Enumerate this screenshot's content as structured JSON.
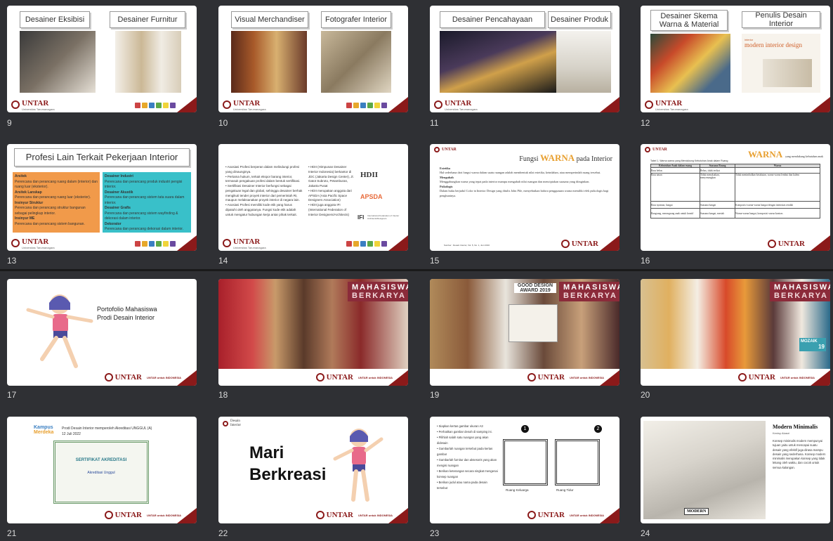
{
  "slides": {
    "s9": {
      "num": "9",
      "title_a": "Desainer Eksibisi",
      "title_b": "Desainer Furnitur"
    },
    "s10": {
      "num": "10",
      "title_a": "Visual Merchandiser",
      "title_b": "Fotografer Interior"
    },
    "s11": {
      "num": "11",
      "title_a": "Desainer Pencahayaan",
      "title_b": "Desainer Produk"
    },
    "s12": {
      "num": "12",
      "title_a": "Desainer Skema Warna & Material",
      "title_b": "Penulis Desain Interior",
      "book_small": "interior",
      "book_title": "modern interior design"
    },
    "s13": {
      "num": "13",
      "title": "Profesi Lain Terkait Pekerjaan Interior",
      "left": [
        {
          "h": "Arsitek",
          "d": "Perencana dan perancang ruang dalam (interior) dan ruang luar (eksterior)."
        },
        {
          "h": "Arsitek Lanskap",
          "d": "Perencana dan perancang ruang luar (eksterior)."
        },
        {
          "h": "Insinyur Struktur",
          "d": "Perencana dan perancang struktur bangunan sebagai pelingkup interior."
        },
        {
          "h": "Insinyur ME",
          "d": "Perencana dan perancang sistem bangunan."
        }
      ],
      "right": [
        {
          "h": "Desainer Industri",
          "d": "Perencana dan perancang produk industri pengisi interior."
        },
        {
          "h": "Desainer Akustik",
          "d": "Perencana dan perancang sistem tata suara dalam interior."
        },
        {
          "h": "Desainer Grafis",
          "d": "Perencana dan perancang sistem wayfinding & dekorasi dalam interior."
        },
        {
          "h": "Dekorator",
          "d": "Perencana dan perancang dekorasi dalam interior."
        }
      ]
    },
    "s14": {
      "num": "14",
      "bullets": [
        "Asosiasi Profesi berperan dalam melindungi profesi yang dinaunginya.",
        "Pertama hukum, terkait ekspor barang interior, termasuk pengakuan profesi dalam bentuk sertifikasi.",
        "Sertifikasi Desainer Interior berfungsi sebagai pengakuan legal dan global, sehingga desainer berhak mengikuti tender proyek interior dari pemerintah RI, maupun melaksanakan proyek interior di negara lain.",
        "Asosiasi Profesi memiliki kode etik yang harus dipatuhi oleh anggotanya. Fungsi kode etik adalah untuk mengatur hubungan kerja antar pihak terkait."
      ],
      "orgs": [
        "HDII (Himpunan Desainer Interior Indonesia) berkantor di JDC (Jakarta Design Center), Jl. Gatot Subroto, Petamburan, Jakarta Pusat",
        "HDII merupakan anggota dari APSDA (Asia Pacific Space Designers Association)",
        "HDII juga anggota IFI (International Federation of Interior Designers/Architects)"
      ],
      "logo1": "HDII",
      "logo2": "APSDA",
      "logo3": "IFI",
      "logo3_sub": "International Federation of Interior Architects/Designers"
    },
    "s15": {
      "num": "15",
      "title_pre": "Fungsi",
      "title_w": "WARNA",
      "title_post": "pada Interior",
      "items": [
        {
          "h": "Estetika",
          "d": "Hal sederhana dari fungsi warna dalam suatu ruangan adalah membentuk nilai estetika, keindahan, atau memperindah ruang tersebut."
        },
        {
          "h": "Mengubah",
          "d": "Menggabungkan warna yang tepat pada interior mampu mengubah nilai ruangan dan menciptakan suasana yang diinginkan."
        },
        {
          "h": "Psikologis",
          "d": "Dalam buku berjudul Color in Interior Design yang ditulis John Pile, menyebutkan bahwa penggunaan warna memiliki efek psikologis bagi penghuninya."
        }
      ],
      "source": "Sumber : Desain Interior, Vol. 5, No. 1, Juni 2016"
    },
    "s16": {
      "num": "16",
      "title_w": "WARNA",
      "title_post": "yang mendukung kebutuhan anak",
      "caption": "Tabel 1. Warna-warna yang Mendukung Kebutuhan Anak dalam Ruang",
      "headers": [
        "Kebutuhan Anak dalam ruang",
        "Suasana Ruang",
        "Warna"
      ],
      "rows": [
        [
          "Rasa bebas",
          "Bebas, tidak terikat",
          ""
        ],
        [
          "Rasa aman",
          "Tidak menakutkan, menyenangkan",
          "Tidak menimbulkan ketakutan, warna-warna lembut dan kalem"
        ],
        [
          "Rasa nyaman, hangat",
          "Suasana hangat",
          "Komposisi warna-warna hangat dengan intensitas rendah"
        ],
        [
          "Rangsang, merangsang anak untuk kreatif",
          "Suasana hangat, meriah",
          "Warna-warna hangat, komposisi warna kontras"
        ]
      ],
      "footer": "UNTAR untuk INDONESIA"
    },
    "s17": {
      "num": "17",
      "title_line1": "Portofolio Mahasiswa",
      "title_line2": "Prodi Desain Interior",
      "footer": "UNTAR untuk INDONESIA"
    },
    "s18": {
      "num": "18",
      "banner1": "MAHASISWA",
      "banner2": "BERKARYA",
      "footer": "UNTAR untuk INDONESIA"
    },
    "s19": {
      "num": "19",
      "banner1": "MAHASISWA",
      "banner2": "BERKARYA",
      "award1": "GOOD DESIGN",
      "award2": "AWARD 2019",
      "footer": "UNTAR untuk INDONESIA"
    },
    "s20": {
      "num": "20",
      "banner1": "MAHASISWA",
      "banner2": "BERKARYA",
      "mozaik": "MOZAIK",
      "mozaik_year": "19",
      "footer": "UNTAR untuk INDONESIA"
    },
    "s21": {
      "num": "21",
      "kampus1": "Kampus",
      "kampus2": "Merdeka",
      "headline": "Prodi Desain Interior memperoleh Akreditasi UNGGUL (A)",
      "date": "12 Juli 2022",
      "cert_title": "SERTIFIKAT AKREDITASI",
      "cert_grade": "Akreditasi Unggul",
      "footer": "UNTAR untuk INDONESIA"
    },
    "s22": {
      "num": "22",
      "label_small1": "Desain",
      "label_small2": "Interior",
      "title1": "Mari",
      "title2": "Berkreasi",
      "footer": "UNTAR untuk INDONESIA"
    },
    "s23": {
      "num": "23",
      "bullets": [
        "Siapkan kertas gambar ukuran A3",
        "Perhatikan gambar denah di samping ini.",
        "Pilihlah salah satu ruangan yang akan didesain",
        "Gambarlah ruangan tersebut pada kertas gambar",
        "Gambarlah furnitur dan aksesoris yang akan mengisi ruangan",
        "Berikan keterangan secara singkat mengenai konsep ruangan",
        "Berikan judul atau nama pada desain tersebut"
      ],
      "box1_num": "1",
      "box2_num": "2",
      "box1_label": "Ruang Keluarga",
      "box2_label": "Ruang Tidur",
      "footer": "UNTAR untuk INDONESIA"
    },
    "s24": {
      "num": "24",
      "title": "Modern Minimalis",
      "author": "Kenisy Akasri",
      "body": "Konsep minimalis modern mempunyai tujuan yaitu untuk mencapai suatu desain yang efektif juga dirasa mampu desain yang sederhana. Konsep modern minimalis merupakan konsep yang tidak lekang oleh waktu, dan cocok untuk semua kalangan.",
      "sketch_label": "MODERN"
    }
  },
  "brand": {
    "name": "UNTAR",
    "sub": "Universitas Tarumanagara",
    "accent": "#8b1a1a"
  }
}
